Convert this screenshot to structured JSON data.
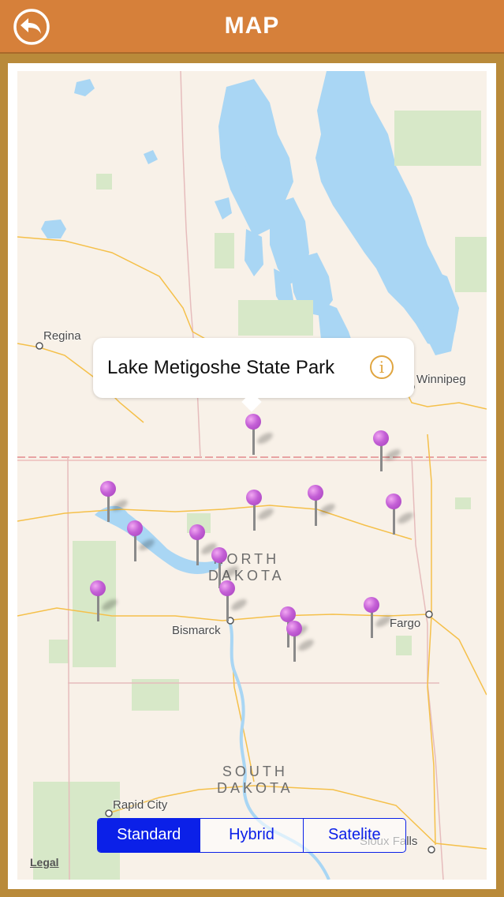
{
  "header": {
    "title": "MAP",
    "back_icon": "back-arrow-icon"
  },
  "map": {
    "cities": [
      {
        "name": "Regina"
      },
      {
        "name": "Winnipeg"
      },
      {
        "name": "Bismarck"
      },
      {
        "name": "Fargo"
      },
      {
        "name": "Rapid City"
      },
      {
        "name": "Sioux Falls"
      }
    ],
    "states": {
      "north_dakota": "NORTH\nDAKOTA",
      "south_dakota": "SOUTH\nDAKOTA"
    },
    "pin_color": "#c460d6",
    "pin_count": 14,
    "legal": "Legal"
  },
  "callout": {
    "title": "Lake Metigoshe State Park",
    "info_icon": "info-icon",
    "info_glyph": "i"
  },
  "map_type": {
    "options": [
      "Standard",
      "Hybrid",
      "Satelite"
    ],
    "selected": "Standard"
  },
  "colors": {
    "header": "#d6803a",
    "accent": "#0b20e8",
    "info": "#e0a540",
    "water": "#a9d6f4",
    "park": "#d7e8c8",
    "road": "#f5c04a"
  }
}
